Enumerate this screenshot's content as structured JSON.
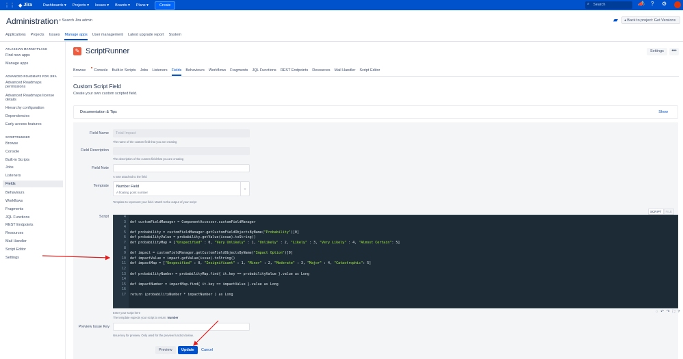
{
  "topnav": {
    "product": "Jira",
    "items": [
      "Dashboards ▾",
      "Projects ▾",
      "Issues ▾",
      "Boards ▾",
      "Plans ▾"
    ],
    "create_label": "Create",
    "search_placeholder": "Search"
  },
  "admin": {
    "title": "Administration",
    "search_label": "Search Jira admin",
    "back_label": "Back to project: Get Versions",
    "tabs": [
      "Applications",
      "Projects",
      "Issues",
      "Manage apps",
      "User management",
      "Latest upgrade report",
      "System"
    ],
    "active_tab": "Manage apps"
  },
  "sidebar": {
    "sections": [
      {
        "heading": "ATLASSIAN MARKETPLACE",
        "items": [
          "Find new apps",
          "Manage apps"
        ]
      },
      {
        "heading": "ADVANCED ROADMAPS FOR JIRA",
        "items": [
          "Advanced Roadmaps permissions",
          "Advanced Roadmaps license details",
          "Hierarchy configuration",
          "Dependencies",
          "Early access features"
        ]
      },
      {
        "heading": "SCRIPTRUNNER",
        "items": [
          "Browse",
          "Console",
          "Built-in Scripts",
          "Jobs",
          "Listeners",
          "Fields",
          "Behaviours",
          "Workflows",
          "Fragments",
          "JQL Functions",
          "REST Endpoints",
          "Resources",
          "Mail Handler",
          "Script Editor",
          "Settings"
        ]
      }
    ],
    "active_item": "Fields"
  },
  "scriptrunner": {
    "title": "ScriptRunner",
    "settings_label": "Settings",
    "more_label": "•••",
    "tabs": [
      "Browse",
      "Console",
      "Built-in Scripts",
      "Jobs",
      "Listeners",
      "Fields",
      "Behaviours",
      "Workflows",
      "Fragments",
      "JQL Functions",
      "REST Endpoints",
      "Resources",
      "Mail Handler",
      "Script Editor"
    ],
    "active_tab": "Fields"
  },
  "page": {
    "title": "Custom Script Field",
    "subtitle": "Create your own custom scripted field.",
    "doc_label": "Documentation & Tips",
    "doc_show": "Show"
  },
  "form": {
    "field_name": {
      "label": "Field Name",
      "placeholder": "Total Impact",
      "help": "The name of the custom field that you are creating"
    },
    "field_description": {
      "label": "Field Description",
      "value": "",
      "help": "The description of the custom field that you are creating"
    },
    "field_note": {
      "label": "Field Note",
      "value": "",
      "help": "A note attached to the field"
    },
    "template": {
      "label": "Template",
      "value": "Number Field",
      "sub": "A floating point number",
      "help": "Template to represent your field. Match to the output of your script"
    },
    "script": {
      "label": "Script",
      "tab_script": "SCRIPT",
      "tab_file": "FILE",
      "help": "Enter your script here",
      "help2": "The template expects your script to return:",
      "return_type": "Number",
      "line_numbers": [
        "4",
        "3",
        "4",
        "5",
        "6",
        "7",
        "8",
        "9",
        "10",
        "11",
        "12",
        "13",
        "14",
        "15",
        "16",
        "17"
      ],
      "lines": [
        "",
        "def customFieldManager = ComponentAccessor.customFieldManager",
        "",
        "def probability = customFieldManager.getCustomFieldObjectsByName(\"Probability\")[0]",
        "def probabilityValue = probability.getValue(issue).toString()",
        "def probabilityMap = [\"Unspecified\" : 0, \"Very Unlikely\" : 1, \"Unlikely\" : 2, \"Likely\" : 3, \"Very Likely\" : 4, \"Almost Certain\": 5]",
        "",
        "def impact = customFieldManager.getCustomFieldObjectsByName(\"Impact Option\")[0]",
        "def impactValue = impact.getValue(issue).toString()",
        "def impactMap = [\"Unspecified\" : 0, \"Insignificant\" : 1, \"Minor\" : 2, \"Moderate\" : 3, \"Major\" : 4, \"Catastrophic\": 5]",
        "",
        "def probabilityNumber = probabilityMap.find{ it.key == probabilityValue }.value as Long",
        "",
        "def impactNumber = impactMap.find{ it.key == impactValue }.value as Long",
        "",
        "return (probabilityNumber * impactNumber ) as Long"
      ]
    },
    "preview_issue_key": {
      "label": "Preview Issue Key",
      "value": "",
      "help": "Issue key for preview. Only used for the preview function below."
    },
    "buttons": {
      "preview": "Preview",
      "update": "Update",
      "cancel": "Cancel"
    }
  },
  "colors": {
    "primary": "#0052cc",
    "editor_bg": "#1c2b36",
    "annotation_arrow": "#e02020"
  }
}
